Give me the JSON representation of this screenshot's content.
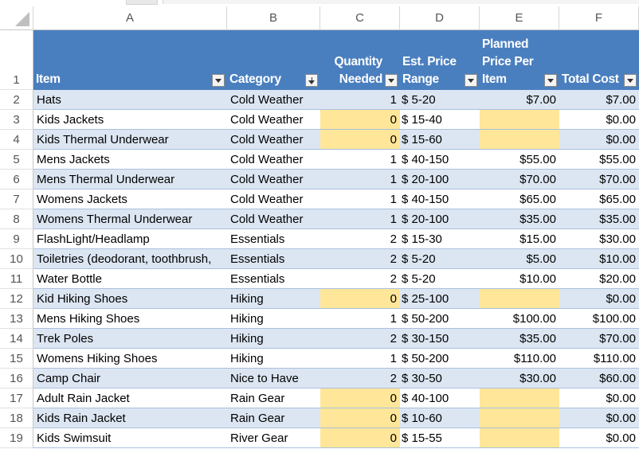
{
  "columns": [
    "A",
    "B",
    "C",
    "D",
    "E",
    "F"
  ],
  "rows_numbers": [
    "1",
    "2",
    "3",
    "4",
    "5",
    "6",
    "7",
    "8",
    "9",
    "10",
    "11",
    "12",
    "13",
    "14",
    "15",
    "16",
    "17",
    "18",
    "19"
  ],
  "headers": {
    "item": "Item",
    "category": "Category",
    "quantity": "Quantity\nNeeded",
    "est_price": "Est. Price\nRange",
    "planned": "Planned\nPrice Per\nItem",
    "total": "Total Cost"
  },
  "rows": [
    {
      "item": "Hats",
      "category": "Cold Weather",
      "qty": "1",
      "range": "$ 5-20",
      "planned": "$7.00",
      "total": "$7.00",
      "missing": false
    },
    {
      "item": "Kids Jackets",
      "category": "Cold Weather",
      "qty": "0",
      "range": "$ 15-40",
      "planned": "",
      "total": "$0.00",
      "missing": true
    },
    {
      "item": "Kids Thermal Underwear",
      "category": "Cold Weather",
      "qty": "0",
      "range": "$ 15-60",
      "planned": "",
      "total": "$0.00",
      "missing": true
    },
    {
      "item": "Mens Jackets",
      "category": "Cold Weather",
      "qty": "1",
      "range": "$ 40-150",
      "planned": "$55.00",
      "total": "$55.00",
      "missing": false
    },
    {
      "item": "Mens Thermal Underwear",
      "category": "Cold Weather",
      "qty": "1",
      "range": "$ 20-100",
      "planned": "$70.00",
      "total": "$70.00",
      "missing": false
    },
    {
      "item": "Womens Jackets",
      "category": "Cold Weather",
      "qty": "1",
      "range": "$ 40-150",
      "planned": "$65.00",
      "total": "$65.00",
      "missing": false
    },
    {
      "item": "Womens Thermal Underwear",
      "category": "Cold Weather",
      "qty": "1",
      "range": "$ 20-100",
      "planned": "$35.00",
      "total": "$35.00",
      "missing": false
    },
    {
      "item": "FlashLight/Headlamp",
      "category": "Essentials",
      "qty": "2",
      "range": "$ 15-30",
      "planned": "$15.00",
      "total": "$30.00",
      "missing": false
    },
    {
      "item": "Toiletries (deodorant, toothbrush,",
      "category": "Essentials",
      "qty": "2",
      "range": "$ 5-20",
      "planned": "$5.00",
      "total": "$10.00",
      "missing": false
    },
    {
      "item": "Water Bottle",
      "category": "Essentials",
      "qty": "2",
      "range": "$ 5-20",
      "planned": "$10.00",
      "total": "$20.00",
      "missing": false
    },
    {
      "item": "Kid Hiking Shoes",
      "category": "Hiking",
      "qty": "0",
      "range": "$ 25-100",
      "planned": "",
      "total": "$0.00",
      "missing": true
    },
    {
      "item": "Mens Hiking Shoes",
      "category": "Hiking",
      "qty": "1",
      "range": "$ 50-200",
      "planned": "$100.00",
      "total": "$100.00",
      "missing": false
    },
    {
      "item": "Trek Poles",
      "category": "Hiking",
      "qty": "2",
      "range": "$ 30-150",
      "planned": "$35.00",
      "total": "$70.00",
      "missing": false
    },
    {
      "item": "Womens Hiking Shoes",
      "category": "Hiking",
      "qty": "1",
      "range": "$ 50-200",
      "planned": "$110.00",
      "total": "$110.00",
      "missing": false
    },
    {
      "item": "Camp Chair",
      "category": "Nice to Have",
      "qty": "2",
      "range": "$ 30-50",
      "planned": "$30.00",
      "total": "$60.00",
      "missing": false
    },
    {
      "item": "Adult Rain Jacket",
      "category": "Rain Gear",
      "qty": "0",
      "range": "$ 40-100",
      "planned": "",
      "total": "$0.00",
      "missing": true
    },
    {
      "item": "Kids Rain Jacket",
      "category": "Rain Gear",
      "qty": "0",
      "range": "$ 10-60",
      "planned": "",
      "total": "$0.00",
      "missing": true
    },
    {
      "item": "Kids Swimsuit",
      "category": "River Gear",
      "qty": "0",
      "range": "$ 15-55",
      "planned": "",
      "total": "$0.00",
      "missing": true
    }
  ],
  "colors": {
    "header_bg": "#4a7fbf",
    "band": "#dce6f2",
    "highlight": "#ffe699"
  }
}
